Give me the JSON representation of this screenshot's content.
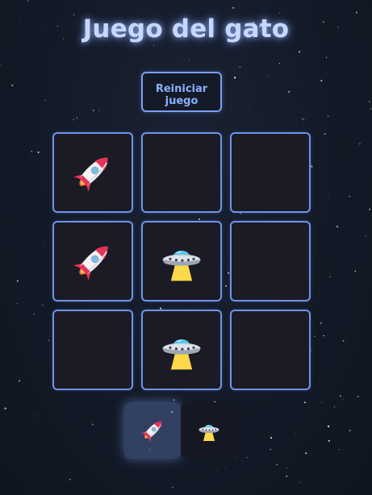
{
  "title": "Juego del gato",
  "reset_button": "Reiniciar juego",
  "board": [
    {
      "mark": "rocket"
    },
    {
      "mark": ""
    },
    {
      "mark": ""
    },
    {
      "mark": "rocket"
    },
    {
      "mark": "ufo"
    },
    {
      "mark": ""
    },
    {
      "mark": ""
    },
    {
      "mark": "ufo"
    },
    {
      "mark": ""
    }
  ],
  "turn": {
    "players": [
      "rocket",
      "ufo"
    ],
    "current": "rocket"
  },
  "colors": {
    "accent": "#6f93ea",
    "cell_bg": "#1b1b25",
    "title": "#c7d7ff"
  },
  "icons": {
    "x_player": "rocket-icon",
    "o_player": "ufo-icon"
  }
}
